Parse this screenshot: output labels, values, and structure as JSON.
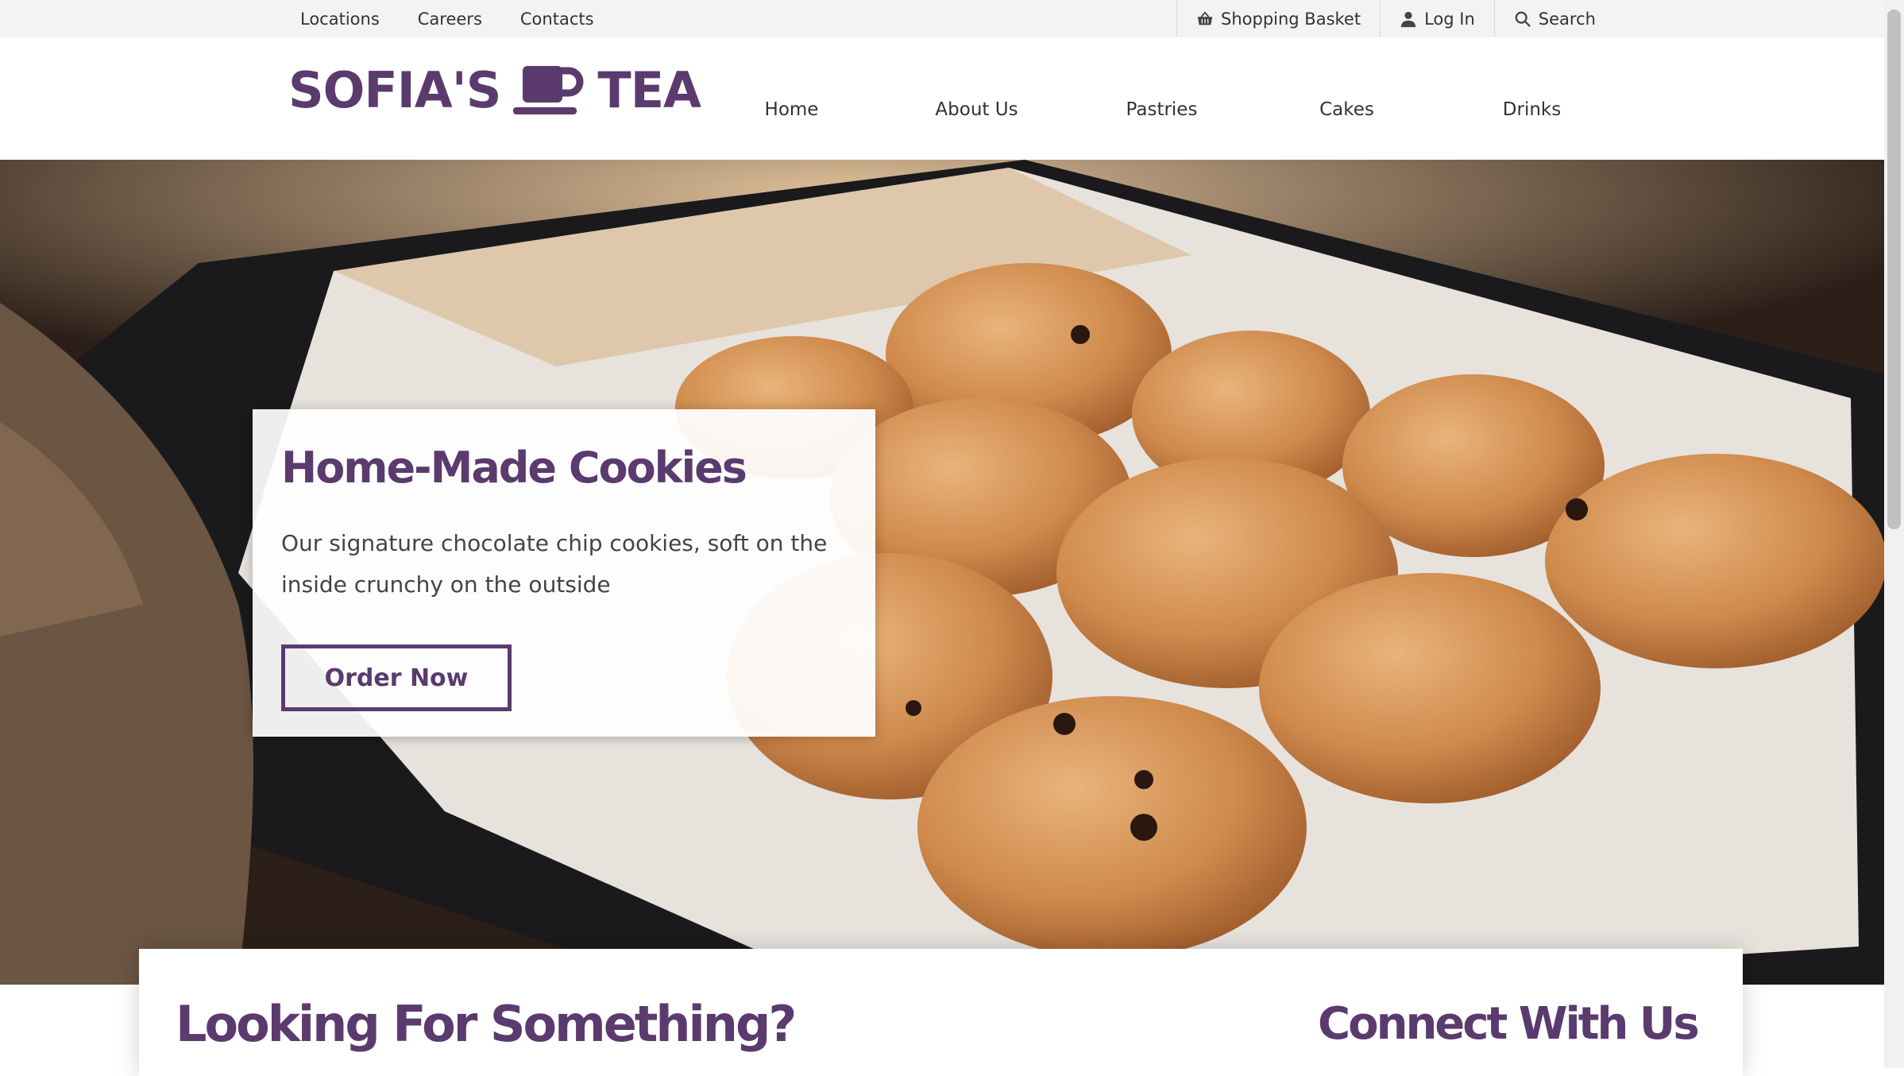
{
  "topbar": {
    "links": [
      "Locations",
      "Careers",
      "Contacts"
    ],
    "basket_label": "Shopping Basket",
    "login_label": "Log In",
    "search_label": "Search"
  },
  "header": {
    "logo_left": "SOFIA'S",
    "logo_right": "TEA",
    "nav": [
      "Home",
      "About Us",
      "Pastries",
      "Cakes",
      "Drinks"
    ]
  },
  "hero": {
    "title": "Home-Made Cookies",
    "description": "Our signature chocolate chip cookies, soft on the inside crunchy on the outside",
    "cta_label": "Order Now"
  },
  "bottom": {
    "looking_heading": "Looking For Something?",
    "connect_heading": "Connect With Us"
  },
  "colors": {
    "brand_purple": "#5b3a6e",
    "topbar_bg": "#f3f3f3"
  }
}
